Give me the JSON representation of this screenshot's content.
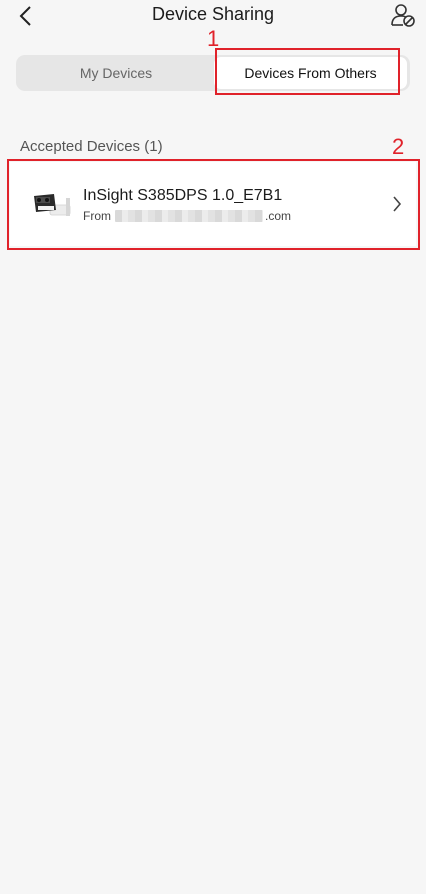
{
  "header": {
    "title": "Device Sharing",
    "back_icon": "chevron-left-icon",
    "profile_icon": "user-block-icon"
  },
  "tabs": [
    {
      "label": "My Devices",
      "selected": false
    },
    {
      "label": "Devices From Others",
      "selected": true
    }
  ],
  "annotations": {
    "first": "1",
    "second": "2",
    "color": "#e0222a"
  },
  "section": {
    "label": "Accepted Devices (1)"
  },
  "device": {
    "name": "InSight S385DPS 1.0_E7B1",
    "from_prefix": "From",
    "from_suffix": ".com",
    "icon": "camera-device-icon"
  }
}
